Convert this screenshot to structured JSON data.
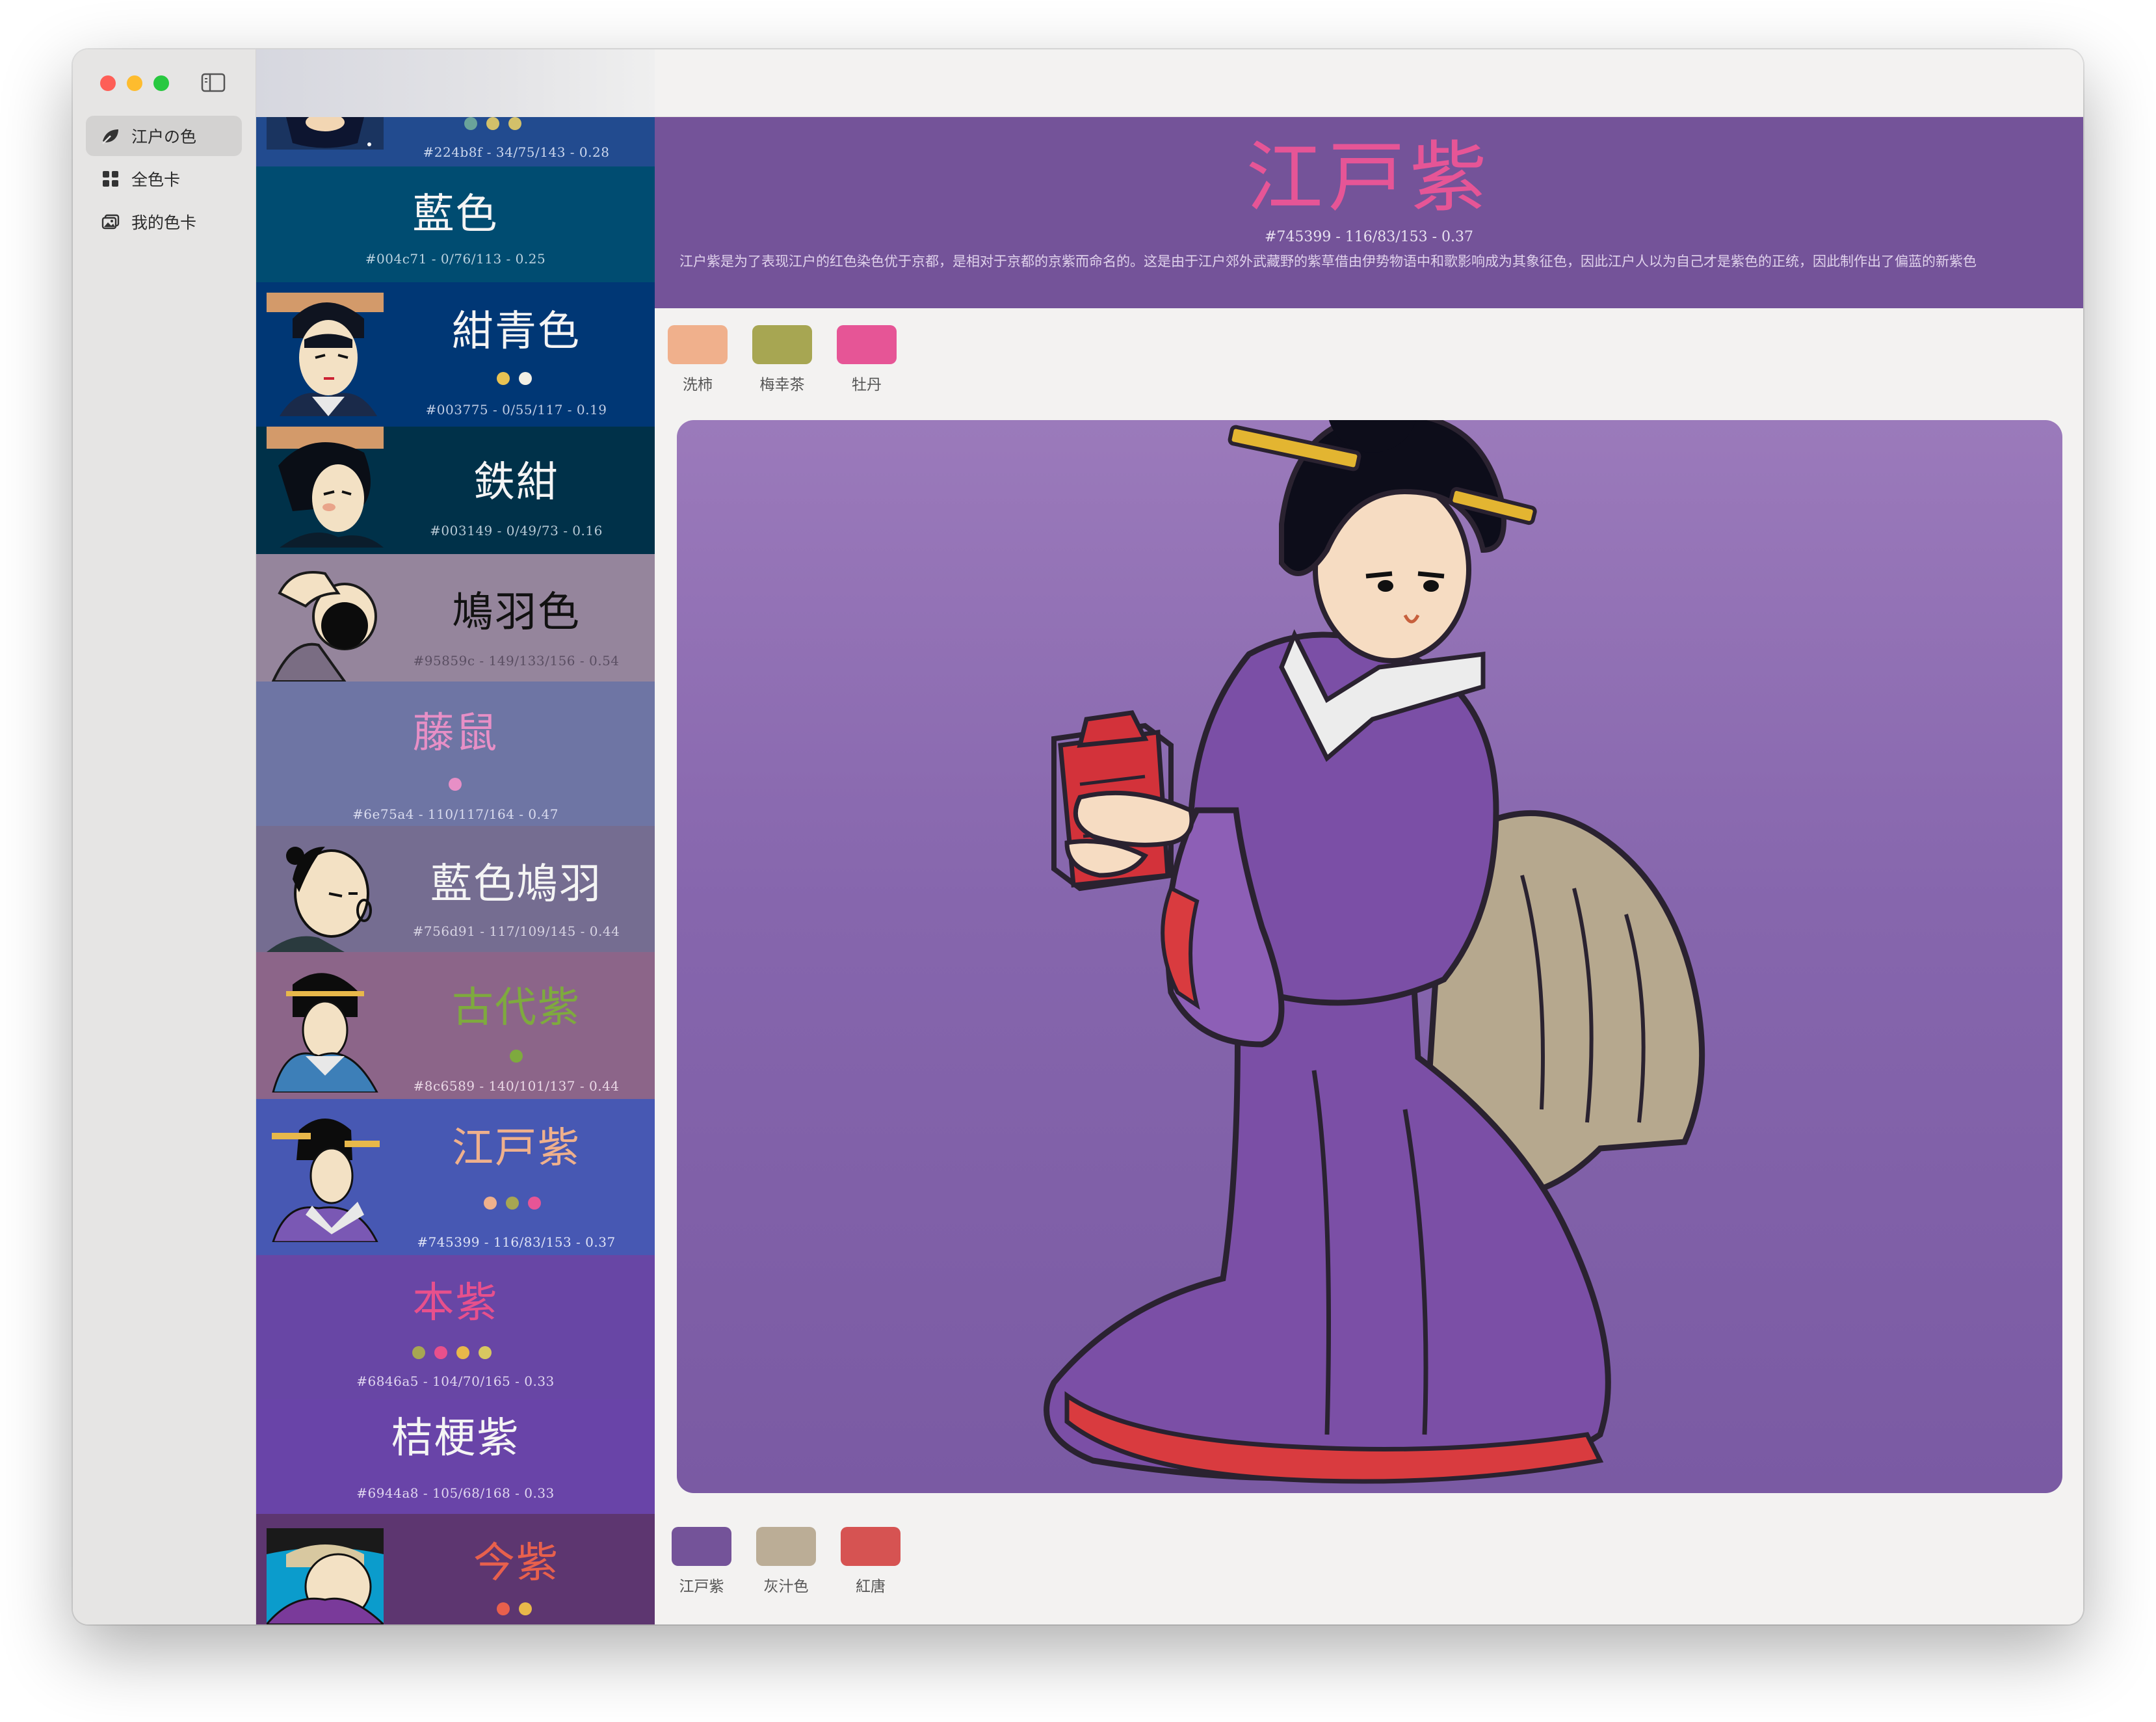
{
  "sidebar": {
    "items": [
      {
        "label": "江户の色",
        "icon": "leaf-icon",
        "active": true
      },
      {
        "label": "全色卡",
        "icon": "grid-icon",
        "active": false
      },
      {
        "label": "我的色卡",
        "icon": "photo-stack-icon",
        "active": false
      }
    ]
  },
  "colors": [
    {
      "name": "",
      "meta": "#224b8f - 34/75/143 - 0.28",
      "bg": "#224b8f"
    },
    {
      "name": "藍色",
      "meta": "#004c71 - 0/76/113 - 0.25",
      "bg": "#004c71"
    },
    {
      "name": "紺青色",
      "meta": "#003775 - 0/55/117 - 0.19",
      "bg": "#003775"
    },
    {
      "name": "鉄紺",
      "meta": "#003149 - 0/49/73 - 0.16",
      "bg": "#003149"
    },
    {
      "name": "鳩羽色",
      "meta": "#95859c - 149/133/156 - 0.54",
      "bg": "#95859c"
    },
    {
      "name": "藤鼠",
      "meta": "#6e75a4 - 110/117/164 - 0.47",
      "bg": "#6e75a4"
    },
    {
      "name": "藍色鳩羽",
      "meta": "#756d91 - 117/109/145 - 0.44",
      "bg": "#756d91"
    },
    {
      "name": "古代紫",
      "meta": "#8c6589 - 140/101/137 - 0.44",
      "bg": "#8c6589"
    },
    {
      "name": "江戸紫",
      "meta": "#745399 - 116/83/153 - 0.37",
      "bg": "#4758b3"
    },
    {
      "name": "本紫",
      "meta": "#6846a5 - 104/70/165 - 0.33",
      "bg": "#6846a5"
    },
    {
      "name": "桔梗紫",
      "meta": "#6944a8 - 105/68/168 - 0.33",
      "bg": "#6944a8"
    },
    {
      "name": "今紫",
      "meta": "",
      "bg": "#5d3670"
    }
  ],
  "detail": {
    "title": "江戸紫",
    "meta": "#745399 - 116/83/153 - 0.37",
    "description": "江户紫是为了表现江户的红色染色优于京都，是相对于京都的京紫而命名的。这是由于江户郊外武藏野的紫草借由伊势物语中和歌影响成为其象征色，因此江户人以为自己才是紫色的正统，因此制作出了偏蓝的新紫色",
    "top_swatches": [
      {
        "label": "洗柿",
        "color": "#f0b08c"
      },
      {
        "label": "梅幸茶",
        "color": "#a7a652"
      },
      {
        "label": "牡丹",
        "color": "#e65596"
      }
    ],
    "bottom_swatches": [
      {
        "label": "江戸紫",
        "color": "#745399"
      },
      {
        "label": "灰汁色",
        "color": "#bbad96"
      },
      {
        "label": "紅唐",
        "color": "#d65352"
      }
    ]
  }
}
